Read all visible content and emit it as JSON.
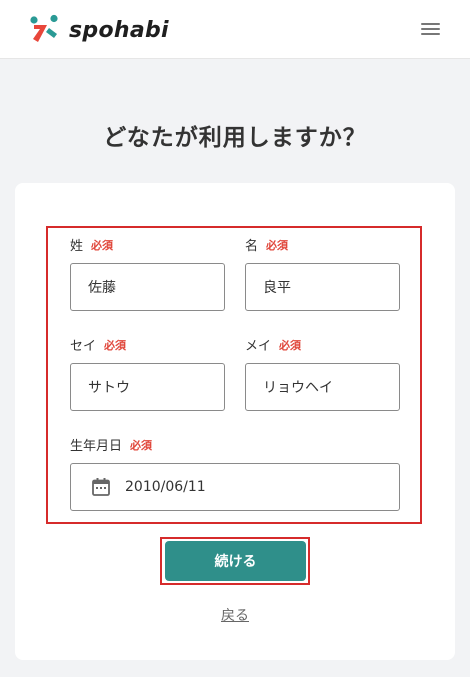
{
  "header": {
    "brand": "spohabi",
    "logo_icon": "spohabi-logo-icon",
    "menu_icon": "hamburger-menu-icon"
  },
  "page": {
    "title": "どなたが利用しますか？"
  },
  "form": {
    "required_badge": "必須",
    "last_name": {
      "label": "姓",
      "value": "佐藤"
    },
    "first_name": {
      "label": "名",
      "value": "良平"
    },
    "last_name_kana": {
      "label": "セイ",
      "value": "サトウ"
    },
    "first_name_kana": {
      "label": "メイ",
      "value": "リョウヘイ"
    },
    "birthdate": {
      "label": "生年月日",
      "value": "2010/06/11",
      "icon": "calendar-icon"
    }
  },
  "actions": {
    "continue_label": "続ける",
    "back_label": "戻る"
  },
  "colors": {
    "accent": "#2f8f8a",
    "required": "#e0463a",
    "highlight_border": "#d62b2b",
    "logo_red": "#e8463a",
    "logo_teal": "#2a9a95"
  }
}
